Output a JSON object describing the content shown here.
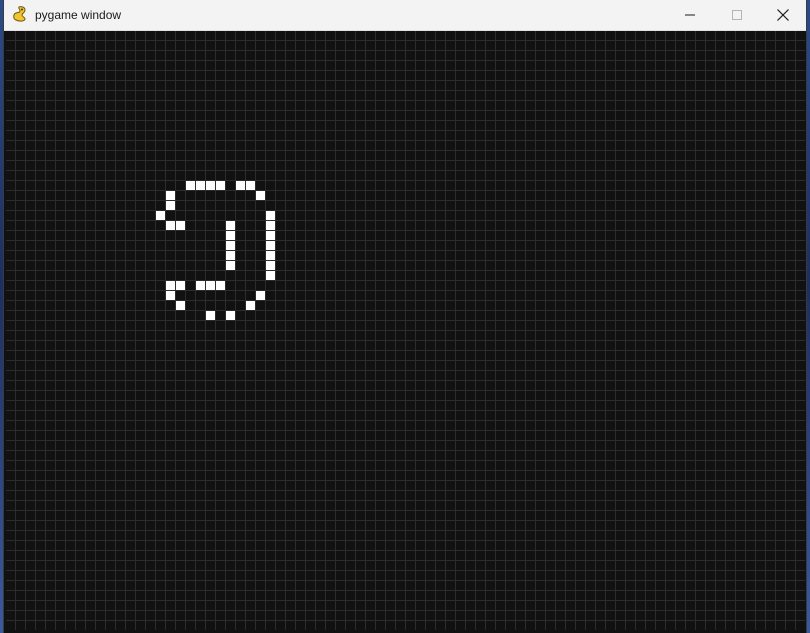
{
  "window": {
    "title": "pygame window",
    "icon": "pygame-snake-icon",
    "controls": {
      "minimize_icon": "minimize-icon",
      "maximize_icon": "maximize-icon",
      "close_icon": "close-icon"
    }
  },
  "board": {
    "cell_color": "#ffffff",
    "background_color": "#111111",
    "grid_line_color": "#2c2c2c",
    "live_cells": [
      [
        18,
        15
      ],
      [
        19,
        15
      ],
      [
        20,
        15
      ],
      [
        21,
        15
      ],
      [
        23,
        15
      ],
      [
        24,
        15
      ],
      [
        16,
        16
      ],
      [
        25,
        16
      ],
      [
        16,
        17
      ],
      [
        15,
        18
      ],
      [
        26,
        18
      ],
      [
        16,
        19
      ],
      [
        17,
        19
      ],
      [
        22,
        19
      ],
      [
        26,
        19
      ],
      [
        22,
        20
      ],
      [
        26,
        20
      ],
      [
        22,
        21
      ],
      [
        26,
        21
      ],
      [
        22,
        22
      ],
      [
        26,
        22
      ],
      [
        22,
        23
      ],
      [
        26,
        23
      ],
      [
        26,
        24
      ],
      [
        16,
        25
      ],
      [
        17,
        25
      ],
      [
        19,
        25
      ],
      [
        20,
        25
      ],
      [
        21,
        25
      ],
      [
        16,
        26
      ],
      [
        25,
        26
      ],
      [
        17,
        27
      ],
      [
        24,
        27
      ],
      [
        20,
        28
      ],
      [
        22,
        28
      ]
    ]
  }
}
